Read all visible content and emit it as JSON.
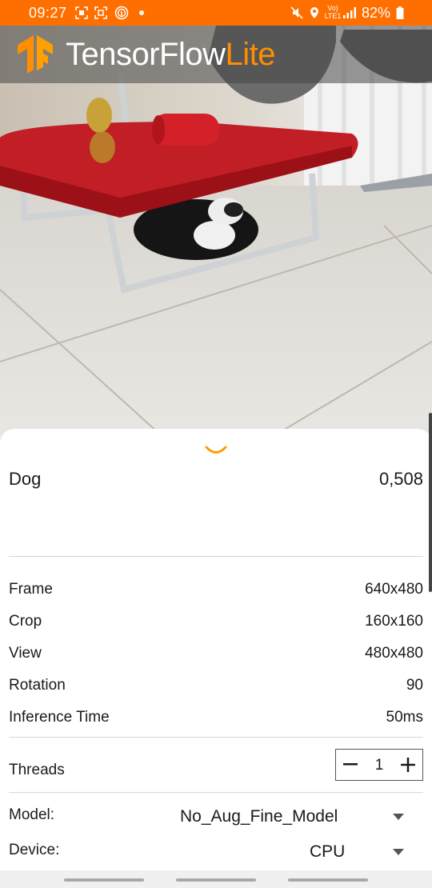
{
  "status_bar": {
    "time": "09:27",
    "volte": "Vo)\nLTE1",
    "battery": "82%",
    "icons": [
      "screenshot-icon",
      "screenshot-icon",
      "fingerprint-icon",
      "notification-dot",
      "mute-icon",
      "location-icon",
      "volte-icon",
      "signal-icon",
      "battery-icon"
    ]
  },
  "app_bar": {
    "logo_text_main": "TensorFlow",
    "logo_text_accent": "Lite",
    "logo_icon": "tensorflow-logo"
  },
  "colors": {
    "accent": "#ff6f00",
    "logo_accent": "#ff8f00"
  },
  "result": {
    "label": "Dog",
    "score": "0,508"
  },
  "info": {
    "frame_label": "Frame",
    "frame_value": "640x480",
    "crop_label": "Crop",
    "crop_value": "160x160",
    "view_label": "View",
    "view_value": "480x480",
    "rotation_label": "Rotation",
    "rotation_value": "90",
    "inference_label": "Inference Time",
    "inference_value": "50ms"
  },
  "threads": {
    "label": "Threads",
    "value": "1"
  },
  "model": {
    "label": "Model:",
    "value": "No_Aug_Fine_Model"
  },
  "device": {
    "label": "Device:",
    "value": "CPU"
  }
}
